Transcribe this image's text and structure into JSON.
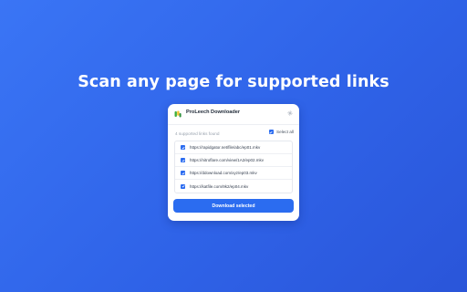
{
  "headline": "Scan any page for supported links",
  "popup": {
    "title": "ProLeech Downloader",
    "found_text": "4 supported links found",
    "select_all_label": "Select all",
    "select_all_checked": true,
    "links": [
      {
        "url": "https://rapidgator.net/file/abc/ep01.mkv",
        "checked": true
      },
      {
        "url": "https://nitroflare.com/view/1A2/ep02.mkv",
        "checked": true
      },
      {
        "url": "https://ddownload.com/xyz/ep03.mkv",
        "checked": true
      },
      {
        "url": "https://katfile.com/9k2/ep04.mkv",
        "checked": true
      }
    ],
    "download_button": "Download selected"
  },
  "colors": {
    "background": "#3069ef",
    "accent": "#2b6cf0",
    "logo_green": "#3fae3b",
    "logo_yellow": "#f2c230"
  },
  "icons": {
    "logo": "leech-logo-icon",
    "settings": "gear-icon",
    "checkbox": "checkbox-checked-icon"
  }
}
